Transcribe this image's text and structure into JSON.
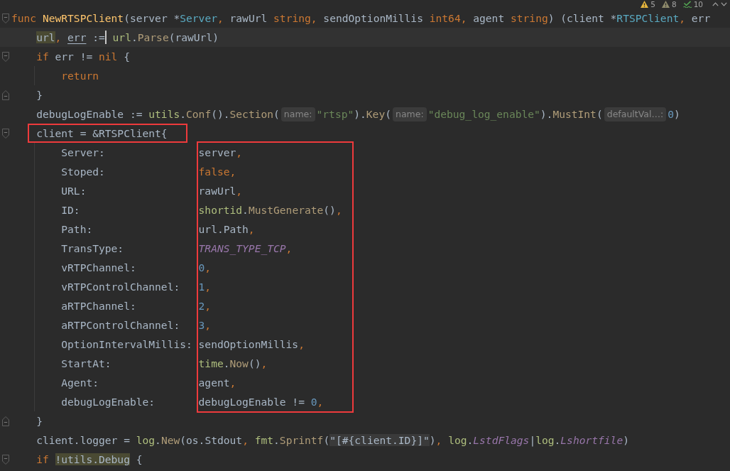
{
  "inspections": [
    {
      "kind": "warning",
      "count": "5"
    },
    {
      "kind": "weak_warning",
      "count": "8"
    },
    {
      "kind": "typo",
      "count": "10"
    }
  ],
  "lines": [
    {
      "kind": "fold-start",
      "annotated": false,
      "tokens": [
        {
          "kind": "keyword",
          "text": "func "
        },
        {
          "kind": "function",
          "text": "NewRTSPClient"
        },
        {
          "kind": "plain",
          "text": "(server *"
        },
        {
          "kind": "type",
          "text": "Server"
        },
        {
          "kind": "comma",
          "text": ","
        },
        {
          "kind": "plain",
          "text": " rawUrl "
        },
        {
          "kind": "keyword",
          "text": "string"
        },
        {
          "kind": "comma",
          "text": ","
        },
        {
          "kind": "plain",
          "text": " sendOptionMillis "
        },
        {
          "kind": "keyword",
          "text": "int64"
        },
        {
          "kind": "comma",
          "text": ","
        },
        {
          "kind": "plain",
          "text": " agent "
        },
        {
          "kind": "keyword",
          "text": "string"
        },
        {
          "kind": "plain",
          "text": ") (client *"
        },
        {
          "kind": "type",
          "text": "RTSPClient"
        },
        {
          "kind": "comma",
          "text": ","
        },
        {
          "kind": "plain",
          "text": " err"
        }
      ],
      "children": [
        {
          "kind": "code",
          "annotated": false,
          "tokens": [
            {
              "kind": "highlighted",
              "text": "url"
            },
            {
              "kind": "comma",
              "text": ", "
            },
            {
              "kind": "underlined",
              "text": "err"
            },
            {
              "kind": "plain",
              "text": " :="
            },
            {
              "kind": "caret"
            },
            {
              "kind": "package",
              "text": " url"
            },
            {
              "kind": "plain",
              "text": "."
            },
            {
              "kind": "method",
              "text": "Parse"
            },
            {
              "kind": "plain",
              "text": "(rawUrl)"
            }
          ]
        },
        {
          "kind": "fold-start",
          "annotated": false,
          "tokens": [
            {
              "kind": "keyword",
              "text": "if"
            },
            {
              "kind": "plain",
              "text": " err != "
            },
            {
              "kind": "keyword",
              "text": "nil"
            },
            {
              "kind": "plain",
              "text": " {"
            }
          ],
          "children": [
            {
              "kind": "code",
              "annotated": false,
              "tokens": [
                {
                  "kind": "keyword",
                  "text": "return"
                }
              ]
            }
          ]
        },
        {
          "kind": "fold-end",
          "annotated": false,
          "tokens": [
            {
              "kind": "plain",
              "text": "}"
            }
          ]
        },
        {
          "kind": "code",
          "annotated": false,
          "tokens": [
            {
              "kind": "plain",
              "text": "debugLogEnable := "
            },
            {
              "kind": "package",
              "text": "utils"
            },
            {
              "kind": "plain",
              "text": "."
            },
            {
              "kind": "method",
              "text": "Conf"
            },
            {
              "kind": "plain",
              "text": "()."
            },
            {
              "kind": "method",
              "text": "Section"
            },
            {
              "kind": "plain",
              "text": "("
            },
            {
              "kind": "hint",
              "text": "name:"
            },
            {
              "kind": "string",
              "text": "\"rtsp\""
            },
            {
              "kind": "plain",
              "text": ")."
            },
            {
              "kind": "method",
              "text": "Key"
            },
            {
              "kind": "plain",
              "text": "("
            },
            {
              "kind": "hint",
              "text": "name:"
            },
            {
              "kind": "string",
              "text": "\"debug_log_enable\""
            },
            {
              "kind": "plain",
              "text": ")."
            },
            {
              "kind": "method",
              "text": "MustInt"
            },
            {
              "kind": "plain",
              "text": "("
            },
            {
              "kind": "hint",
              "text": "defaultVal…:"
            },
            {
              "kind": "number",
              "text": "0"
            },
            {
              "kind": "plain",
              "text": ")"
            }
          ]
        },
        {
          "kind": "fold-start",
          "annotated": true,
          "tokens": [
            {
              "kind": "plain",
              "text": "client = &RTSPClient{"
            }
          ],
          "struct": {
            "annotated": true,
            "fields": [
              {
                "key": "Server:",
                "value": [
                  {
                    "kind": "plain",
                    "text": "server"
                  },
                  {
                    "kind": "comma",
                    "text": ","
                  }
                ]
              },
              {
                "key": "Stoped:",
                "value": [
                  {
                    "kind": "keyword",
                    "text": "false"
                  },
                  {
                    "kind": "comma",
                    "text": ","
                  }
                ]
              },
              {
                "key": "URL:",
                "value": [
                  {
                    "kind": "plain",
                    "text": "rawUrl"
                  },
                  {
                    "kind": "comma",
                    "text": ","
                  }
                ]
              },
              {
                "key": "ID:",
                "value": [
                  {
                    "kind": "package",
                    "text": "shortid"
                  },
                  {
                    "kind": "plain",
                    "text": "."
                  },
                  {
                    "kind": "method",
                    "text": "MustGenerate"
                  },
                  {
                    "kind": "plain",
                    "text": "()"
                  },
                  {
                    "kind": "comma",
                    "text": ","
                  }
                ]
              },
              {
                "key": "Path:",
                "value": [
                  {
                    "kind": "plain",
                    "text": "url.Path"
                  },
                  {
                    "kind": "comma",
                    "text": ","
                  }
                ]
              },
              {
                "key": "TransType:",
                "value": [
                  {
                    "kind": "constant",
                    "text": "TRANS_TYPE_TCP"
                  },
                  {
                    "kind": "comma",
                    "text": ","
                  }
                ]
              },
              {
                "key": "vRTPChannel:",
                "value": [
                  {
                    "kind": "number",
                    "text": "0"
                  },
                  {
                    "kind": "comma",
                    "text": ","
                  }
                ]
              },
              {
                "key": "vRTPControlChannel:",
                "value": [
                  {
                    "kind": "number",
                    "text": "1"
                  },
                  {
                    "kind": "comma",
                    "text": ","
                  }
                ]
              },
              {
                "key": "aRTPChannel:",
                "value": [
                  {
                    "kind": "number",
                    "text": "2"
                  },
                  {
                    "kind": "comma",
                    "text": ","
                  }
                ]
              },
              {
                "key": "aRTPControlChannel:",
                "value": [
                  {
                    "kind": "number",
                    "text": "3"
                  },
                  {
                    "kind": "comma",
                    "text": ","
                  }
                ]
              },
              {
                "key": "OptionIntervalMillis:",
                "value": [
                  {
                    "kind": "plain",
                    "text": "sendOptionMillis"
                  },
                  {
                    "kind": "comma",
                    "text": ","
                  }
                ]
              },
              {
                "key": "StartAt:",
                "value": [
                  {
                    "kind": "package",
                    "text": "time"
                  },
                  {
                    "kind": "plain",
                    "text": "."
                  },
                  {
                    "kind": "method",
                    "text": "Now"
                  },
                  {
                    "kind": "plain",
                    "text": "()"
                  },
                  {
                    "kind": "comma",
                    "text": ","
                  }
                ]
              },
              {
                "key": "Agent:",
                "value": [
                  {
                    "kind": "plain",
                    "text": "agent"
                  },
                  {
                    "kind": "comma",
                    "text": ","
                  }
                ]
              },
              {
                "key": "debugLogEnable:",
                "value": [
                  {
                    "kind": "plain",
                    "text": "debugLogEnable != "
                  },
                  {
                    "kind": "number",
                    "text": "0"
                  },
                  {
                    "kind": "comma",
                    "text": ","
                  }
                ]
              }
            ]
          }
        },
        {
          "kind": "fold-end",
          "annotated": false,
          "tokens": [
            {
              "kind": "plain",
              "text": "}"
            }
          ]
        },
        {
          "kind": "code",
          "annotated": false,
          "tokens": [
            {
              "kind": "plain",
              "text": "client.logger = "
            },
            {
              "kind": "package",
              "text": "log"
            },
            {
              "kind": "plain",
              "text": "."
            },
            {
              "kind": "method",
              "text": "New"
            },
            {
              "kind": "plain",
              "text": "(os.Stdout"
            },
            {
              "kind": "comma",
              "text": ", "
            },
            {
              "kind": "package",
              "text": "fmt"
            },
            {
              "kind": "plain",
              "text": "."
            },
            {
              "kind": "method",
              "text": "Sprintf"
            },
            {
              "kind": "plain",
              "text": "("
            },
            {
              "kind": "injected",
              "text": "\"[#{client.ID}]\""
            },
            {
              "kind": "plain",
              "text": ")"
            },
            {
              "kind": "comma",
              "text": ", "
            },
            {
              "kind": "package",
              "text": "log"
            },
            {
              "kind": "plain",
              "text": "."
            },
            {
              "kind": "constant",
              "text": "LstdFlags"
            },
            {
              "kind": "plain",
              "text": "|"
            },
            {
              "kind": "package",
              "text": "log"
            },
            {
              "kind": "plain",
              "text": "."
            },
            {
              "kind": "constant",
              "text": "Lshortfile"
            },
            {
              "kind": "plain",
              "text": ")"
            }
          ]
        },
        {
          "kind": "fold-start",
          "annotated": false,
          "tokens": [
            {
              "kind": "keyword",
              "text": "if "
            },
            {
              "kind": "highlighted",
              "text": "!utils.Debug"
            },
            {
              "kind": "plain",
              "text": " {"
            }
          ]
        }
      ]
    }
  ]
}
